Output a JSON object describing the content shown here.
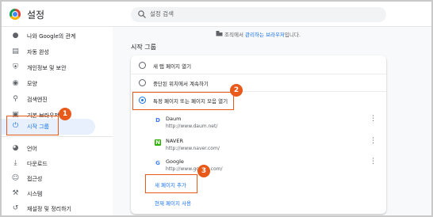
{
  "app": {
    "title": "설정"
  },
  "search": {
    "placeholder": "설정 검색"
  },
  "sidebar": {
    "items": [
      {
        "label": "나와 Google의 관계",
        "icon": "person-icon"
      },
      {
        "label": "자동 완성",
        "icon": "clipboard-icon"
      },
      {
        "label": "개인정보 및 보안",
        "icon": "shield-icon"
      },
      {
        "label": "모양",
        "icon": "palette-icon"
      },
      {
        "label": "검색엔진",
        "icon": "search-icon"
      },
      {
        "label": "기본 브라우저",
        "icon": "browser-icon"
      },
      {
        "label": "시작 그룹",
        "icon": "power-icon",
        "active": true
      },
      {
        "label": "언어",
        "icon": "globe-icon"
      },
      {
        "label": "다운로드",
        "icon": "download-icon"
      },
      {
        "label": "접근성",
        "icon": "accessibility-icon"
      },
      {
        "label": "시스템",
        "icon": "wrench-icon"
      },
      {
        "label": "재설정 및 정리하기",
        "icon": "reset-icon"
      }
    ]
  },
  "notice": {
    "prefix": "조직에서 ",
    "link": "관리하는 브라우저",
    "suffix": "입니다."
  },
  "section": {
    "title": "시작 그룹"
  },
  "options": [
    {
      "label": "새 탭 페이지 열기",
      "selected": false
    },
    {
      "label": "중단된 위치에서 계속하기",
      "selected": false
    },
    {
      "label": "특정 페이지 또는 페이지 모음 열기",
      "selected": true
    }
  ],
  "sites": [
    {
      "name": "Daum",
      "url": "http://www.daum.net/",
      "favicon": "D",
      "color": "#3d6ff3"
    },
    {
      "name": "NAVER",
      "url": "http://www.naver.com/",
      "favicon": "N",
      "color": "#2db400"
    },
    {
      "name": "Google",
      "url": "http://www.google.com/",
      "favicon": "G",
      "color": "#4285f4"
    }
  ],
  "actions": {
    "add_page": "새 페이지 추가",
    "use_current": "현재 페이지 사용"
  },
  "annotations": [
    "1",
    "2",
    "3"
  ],
  "colors": {
    "accent": "#1a73e8",
    "highlight": "#e8591a"
  }
}
